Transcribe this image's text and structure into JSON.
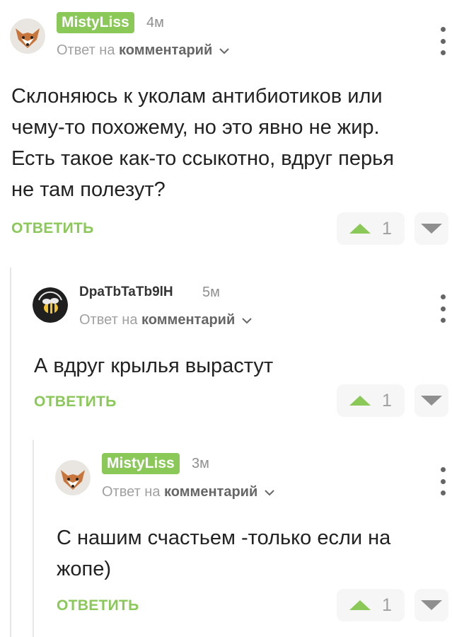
{
  "comments": [
    {
      "username": "MistyLiss",
      "time": "4м",
      "reply_prefix": "Ответ на",
      "reply_target": "комментарий",
      "text_lines": [
        "Склоняюсь к уколам антибиотиков или",
        "чему-то похожему, но это явно не жир.",
        "Есть такое как-то ссыкотно, вдруг перья",
        "не там полезут?"
      ],
      "reply_label": "ОТВЕТИТЬ",
      "votes": "1"
    },
    {
      "username": "DpaTbTaTb9lH",
      "time": "5м",
      "reply_prefix": "Ответ на",
      "reply_target": "комментарий",
      "text_lines": [
        "А вдруг крылья вырастут"
      ],
      "reply_label": "ОТВЕТИТЬ",
      "votes": "1"
    },
    {
      "username": "MistyLiss",
      "time": "3м",
      "reply_prefix": "Ответ на",
      "reply_target": "комментарий",
      "text_lines": [
        "С нашим счастьем -только если на",
        "жопе)"
      ],
      "reply_label": "ОТВЕТИТЬ",
      "votes": "1"
    }
  ],
  "colors": {
    "accent": "#8ac858",
    "vote_bg": "#f6f6f6",
    "muted": "#a0a0a0"
  }
}
